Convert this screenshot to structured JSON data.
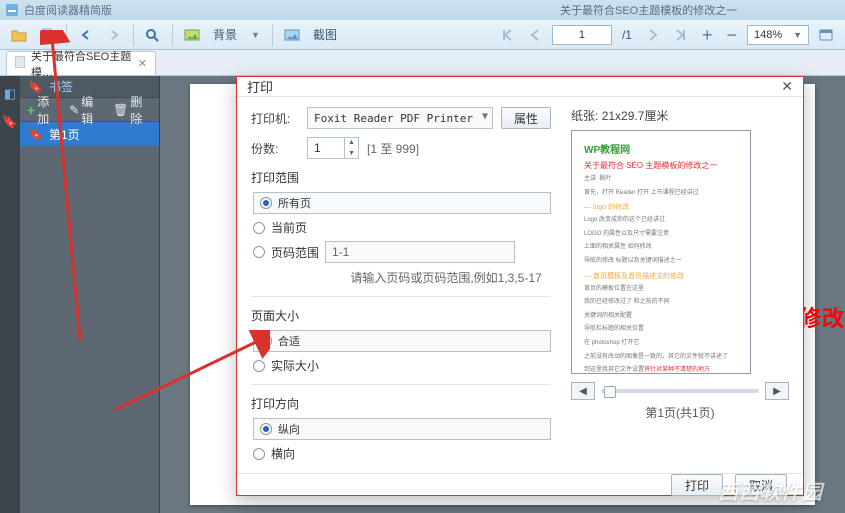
{
  "titlebar": {
    "app_title": "白度阅读器精简版"
  },
  "doc_title_top": "关于最符合SEO主题模板的修改之一",
  "toolbar": {
    "bg_label": "背景",
    "snip_label": "截图",
    "page_current": "1",
    "page_total": "/1",
    "zoom_value": "148%"
  },
  "tabs": {
    "active_tab": "关于最符合SEO主题模…"
  },
  "sidebar": {
    "title": "书签",
    "add": "添加",
    "edit": "编辑",
    "delete": "删除",
    "item1": "第1页"
  },
  "background_red_text": "的修改",
  "dialog": {
    "title": "打印",
    "printer_lbl": "打印机:",
    "printer_value": "Foxit Reader PDF Printer",
    "props_btn": "属性",
    "copies_lbl": "份数:",
    "copies_value": "1",
    "copies_hint": "[1 至 999]",
    "paper_lbl": "纸张:",
    "paper_value": "21x29.7厘米",
    "range_title": "打印范围",
    "range_all": "所有页",
    "range_current": "当前页",
    "range_pages": "页码范围",
    "range_input": "1-1",
    "range_hint": "请输入页码或页码范围,例如1,3,5-17",
    "size_title": "页面大小",
    "size_fit": "合适",
    "size_actual": "实际大小",
    "orient_title": "打印方向",
    "orient_portrait": "纵向",
    "orient_landscape": "横向",
    "preview_counter": "第1页(共1页)",
    "ok": "打印",
    "cancel": "取消"
  },
  "preview": {
    "logo": "WP教程网",
    "headline": "关于最符合 SEO 主题模板的修改之一",
    "sec1": "logo 的修改"
  },
  "watermark": "西西软件园"
}
